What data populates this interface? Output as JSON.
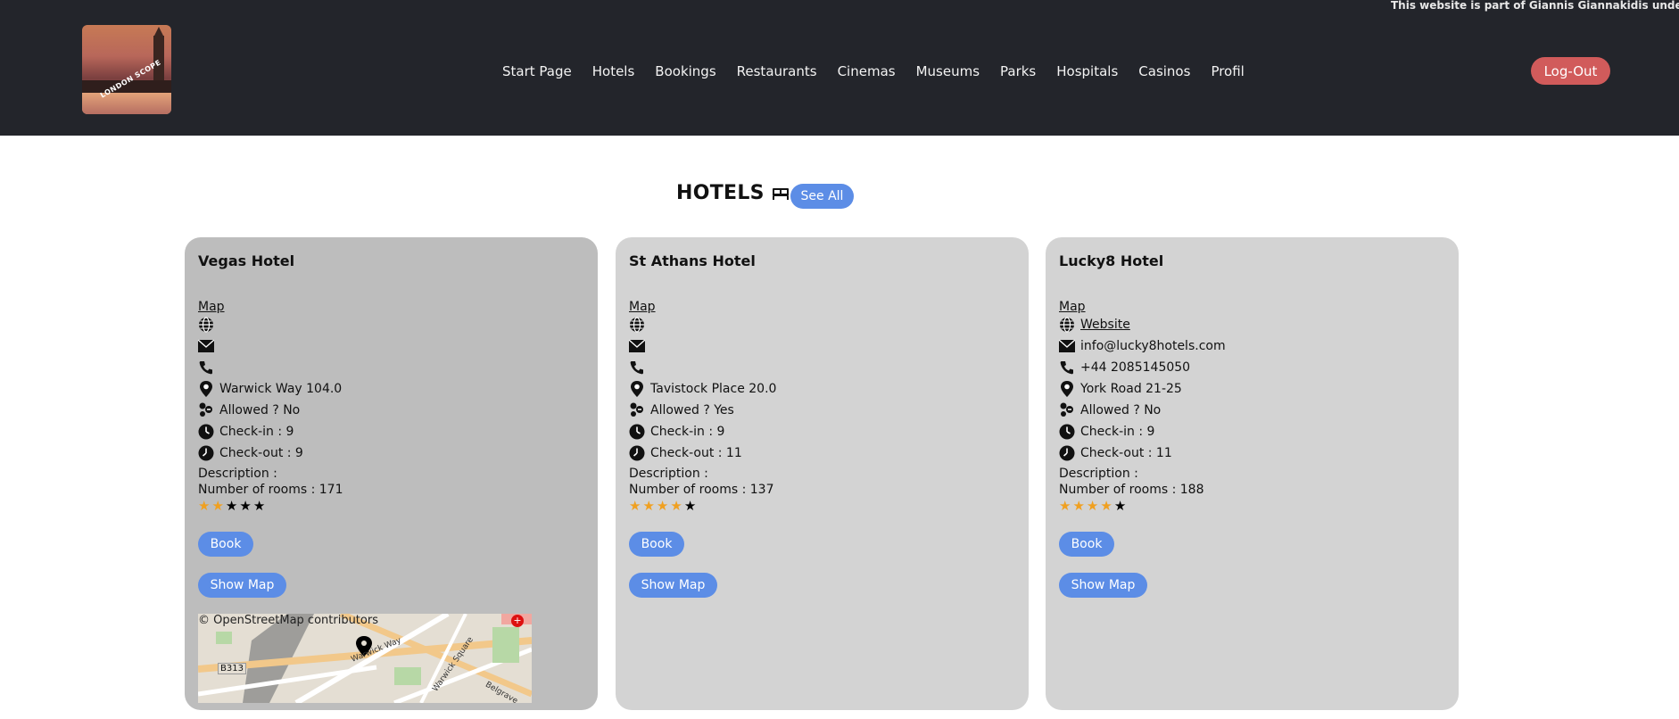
{
  "header": {
    "ticker": "This website is part of Giannis Giannakidis undergrad",
    "logo_alt": "LONDON SCOPE",
    "nav": [
      "Start Page",
      "Hotels",
      "Bookings",
      "Restaurants",
      "Cinemas",
      "Museums",
      "Parks",
      "Hospitals",
      "Casinos",
      "Profil"
    ],
    "logout_label": "Log-Out"
  },
  "section": {
    "title": "HOTELS",
    "icon": "bed-icon",
    "see_all_label": "See All"
  },
  "hotels": [
    {
      "name": "Vegas Hotel",
      "map_link": "Map",
      "website": "",
      "email": "",
      "phone": "",
      "address": "Warwick Way 104.0",
      "pets": "Allowed ? No",
      "checkin": "Check-in : 9",
      "checkout": "Check-out : 9",
      "description": "Description :",
      "rooms": "Number of rooms : 171",
      "rating": 2,
      "book_label": "Book",
      "show_map_label": "Show Map",
      "map_credit": "© OpenStreetMap contributors",
      "map_labels": [
        "B313",
        "Warwick Way",
        "Warwick Square",
        "Belgrave"
      ]
    },
    {
      "name": "St Athans Hotel",
      "map_link": "Map",
      "website": "",
      "email": "",
      "phone": "",
      "address": "Tavistock Place 20.0",
      "pets": "Allowed ? Yes",
      "checkin": "Check-in : 9",
      "checkout": "Check-out : 11",
      "description": "Description :",
      "rooms": "Number of rooms : 137",
      "rating": 4,
      "book_label": "Book",
      "show_map_label": "Show Map"
    },
    {
      "name": "Lucky8 Hotel",
      "map_link": "Map",
      "website": "Website",
      "email": "info@lucky8hotels.com",
      "phone": "+44 2085145050",
      "address": "York Road 21-25",
      "pets": "Allowed ? No",
      "checkin": "Check-in : 9",
      "checkout": "Check-out : 11",
      "description": "Description :",
      "rooms": "Number of rooms : 188",
      "rating": 4,
      "book_label": "Book",
      "show_map_label": "Show Map"
    }
  ],
  "colors": {
    "header_bg": "#23252b",
    "accent_blue": "#5c8de6",
    "logout_red": "#d15b5b",
    "star_on": "#f0a020",
    "card_bg": "#d3d3d3",
    "card_active_bg": "#bdbdbd"
  }
}
